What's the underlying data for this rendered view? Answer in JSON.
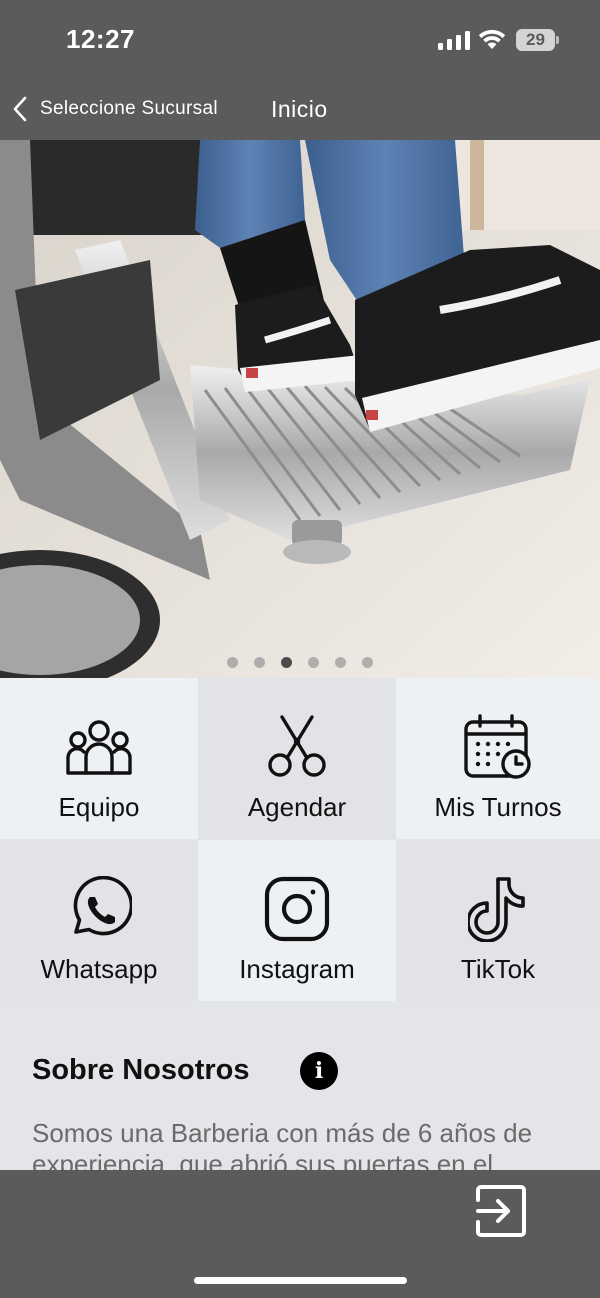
{
  "status_bar": {
    "time": "12:27",
    "battery_level": "29",
    "icons": [
      "signal-icon",
      "wifi-icon",
      "battery-icon"
    ]
  },
  "nav": {
    "back_label": "Seleccione Sucursal",
    "title": "Inicio"
  },
  "carousel": {
    "slide_count": 6,
    "active_index": 2
  },
  "tiles": [
    {
      "label": "Equipo",
      "icon": "team-icon"
    },
    {
      "label": "Agendar",
      "icon": "scissors-icon"
    },
    {
      "label": "Mis Turnos",
      "icon": "calendar-clock-icon"
    },
    {
      "label": "Whatsapp",
      "icon": "whatsapp-icon"
    },
    {
      "label": "Instagram",
      "icon": "instagram-icon"
    },
    {
      "label": "TikTok",
      "icon": "tiktok-icon"
    }
  ],
  "about": {
    "title": "Sobre Nosotros",
    "text": "Somos una Barberia con más de 6 años de experiencia, que abrió sus puertas en el"
  },
  "bottom_bar": {
    "action_icon": "logout-icon"
  },
  "colors": {
    "bar_background": "#5b5b5b",
    "tile_light": "#eef1f4",
    "tile_dark": "#e1e3e6",
    "body_text": "#6b6b6b"
  }
}
